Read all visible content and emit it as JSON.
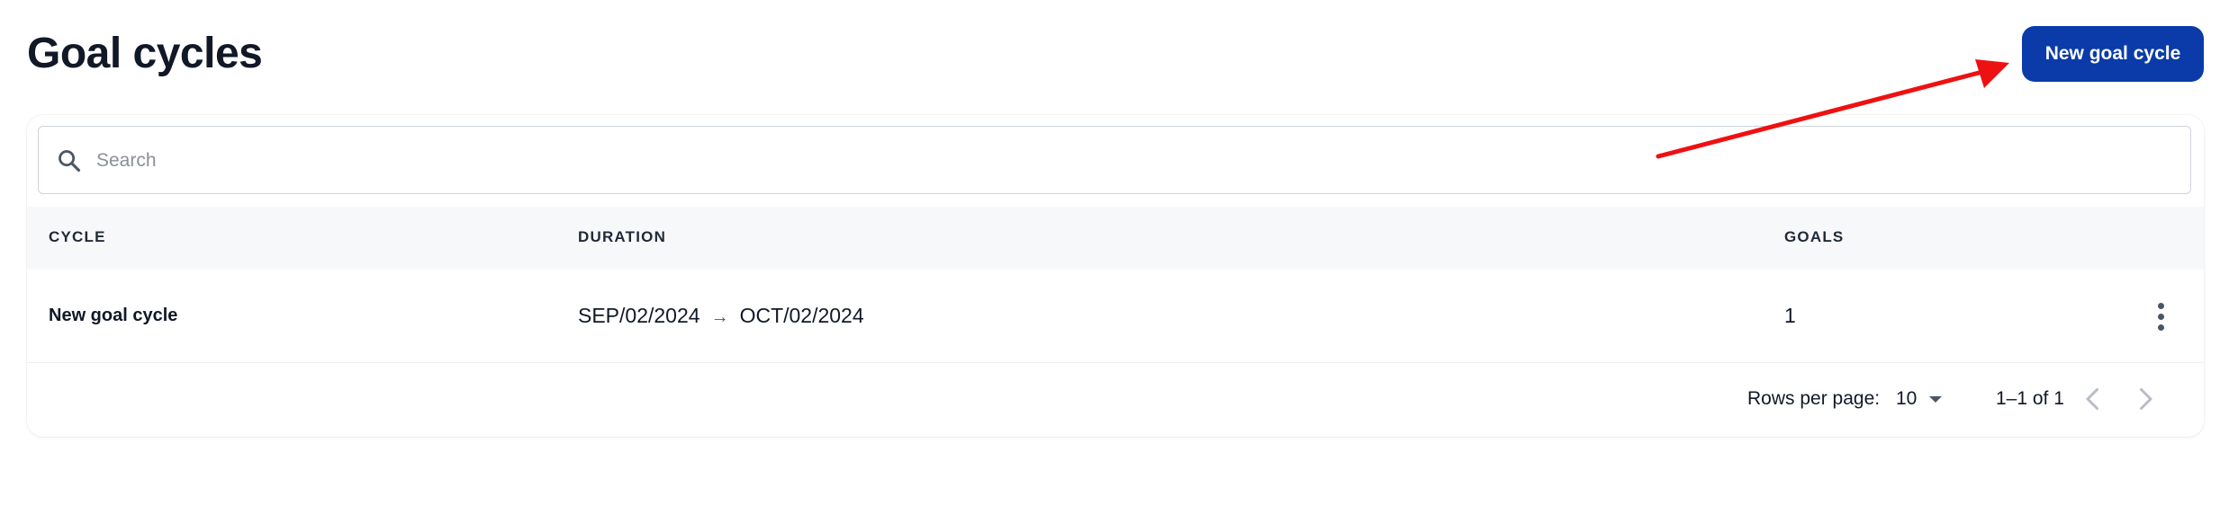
{
  "header": {
    "title": "Goal cycles",
    "new_button_label": "New goal cycle"
  },
  "search": {
    "placeholder": "Search",
    "value": ""
  },
  "table": {
    "columns": [
      "CYCLE",
      "DURATION",
      "GOALS"
    ],
    "rows": [
      {
        "cycle": "New goal cycle",
        "start": "SEP/02/2024",
        "arrow": "→",
        "end": "OCT/02/2024",
        "goals": "1"
      }
    ]
  },
  "pagination": {
    "rows_per_page_label": "Rows per page:",
    "rows_per_page_value": "10",
    "range_label": "1–1 of 1"
  },
  "icons": {
    "search": "search-icon",
    "row_menu": "more-vert-icon",
    "dropdown": "caret-down-icon",
    "prev": "chevron-left-icon",
    "next": "chevron-right-icon"
  },
  "colors": {
    "primary": "#0a3ba8",
    "annotation_arrow": "#ee1111",
    "header_bg": "#f7f8fa"
  }
}
